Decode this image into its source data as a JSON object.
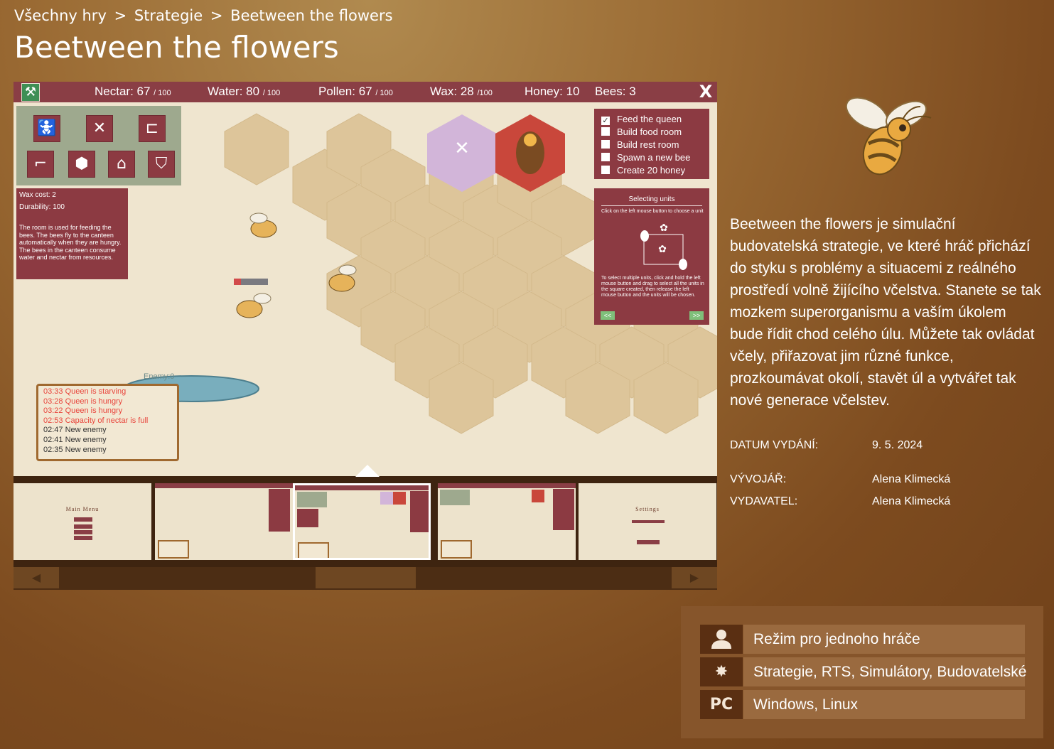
{
  "breadcrumb": {
    "items": [
      "Všechny hry",
      "Strategie",
      "Beetween the flowers"
    ],
    "separator": ">"
  },
  "title": "Beetween the flowers",
  "game_screenshot": {
    "hud": {
      "nectar_label": "Nectar: 67",
      "nectar_max": "/ 100",
      "water_label": "Water: 80",
      "water_max": "/ 100",
      "pollen_label": "Pollen: 67",
      "pollen_max": "/ 100",
      "wax_label": "Wax: 28",
      "wax_max": "/100",
      "honey_label": "Honey: 10",
      "bees_label": "Bees: 3",
      "close_glyph": "X"
    },
    "build_icons": [
      "stroller-icon",
      "fork-knife-icon",
      "bed-icon",
      "honey-dipper-icon",
      "honeycomb-icon",
      "storage-icon",
      "shield-icon"
    ],
    "room_info": {
      "wax_cost": "Wax cost: 2",
      "durability": "Durability: 100",
      "text": "The room is used for feeding the bees. The bees fly to the canteen automatically when they are hungry. The bees in the canteen consume water and nectar from resources."
    },
    "tasks": [
      {
        "label": "Feed the queen",
        "checked": true
      },
      {
        "label": "Build food room",
        "checked": false
      },
      {
        "label": "Build rest room",
        "checked": false
      },
      {
        "label": "Spawn a new bee",
        "checked": false
      },
      {
        "label": "Create 20 honey",
        "checked": false
      }
    ],
    "help": {
      "title": "Selecting units",
      "text1": "Click on the left mouse button to choose a unit",
      "text2": "To select multiple units, click and hold the left mouse button and drag to select all the units in the square created, then release the left mouse button and the units will be chosen.",
      "prev": "<<",
      "next": ">>"
    },
    "enemy_label": "Enemy:0",
    "log": [
      {
        "text": "03:33 Queen is starving",
        "color": "#e8453c"
      },
      {
        "text": "03:28 Queen is hungry",
        "color": "#e8453c"
      },
      {
        "text": "03:22 Queen is hungry",
        "color": "#e8453c"
      },
      {
        "text": "02:53 Capacity of nectar is full",
        "color": "#e8453c"
      },
      {
        "text": "02:47 New enemy",
        "color": "#333333"
      },
      {
        "text": "02:41 New enemy",
        "color": "#333333"
      },
      {
        "text": "02:35 New enemy",
        "color": "#333333"
      }
    ]
  },
  "thumbnails": [
    {
      "title": "Main Menu"
    },
    {
      "title": ""
    },
    {
      "title": ""
    },
    {
      "title": ""
    },
    {
      "title": "Settings"
    }
  ],
  "carousel": {
    "active_index": 2,
    "left_arrow": "◀",
    "right_arrow": "▶"
  },
  "description": "Beetween the flowers je simulační budovatelská strategie, ve které hráč přichází do styku s problémy a situacemi z reálného prostředí volně žijícího včelstva. Stanete se tak mozkem superorganismu a vaším úkolem bude řídit chod celého úlu. Můžete tak ovládat včely, přiřazovat jim různé funkce, prozkoumávat okolí, stavět úl a vytvářet tak nové generace včelstev.",
  "meta": {
    "release_label": "DATUM VYDÁNÍ:",
    "release_value": "9. 5. 2024",
    "developer_label": "VÝVOJÁŘ:",
    "developer_value": "Alena Klimecká",
    "publisher_label": "VYDAVATEL:",
    "publisher_value": "Alena Klimecká"
  },
  "info": {
    "mode": {
      "icon": "user-icon",
      "text": "Režim pro jednoho hráče"
    },
    "genres": {
      "icon": "burst-icon",
      "text": "Strategie, RTS, Simulátory, Budovatelské"
    },
    "platforms": {
      "icon_text": "PC",
      "text": "Windows, Linux"
    }
  },
  "colors": {
    "hud": "#8a3e45",
    "panel": "#8c3a42",
    "page_bg": "#7d4b1f",
    "info_icon_bg": "#5a2f12",
    "info_text_bg": "#9a6a3f"
  }
}
